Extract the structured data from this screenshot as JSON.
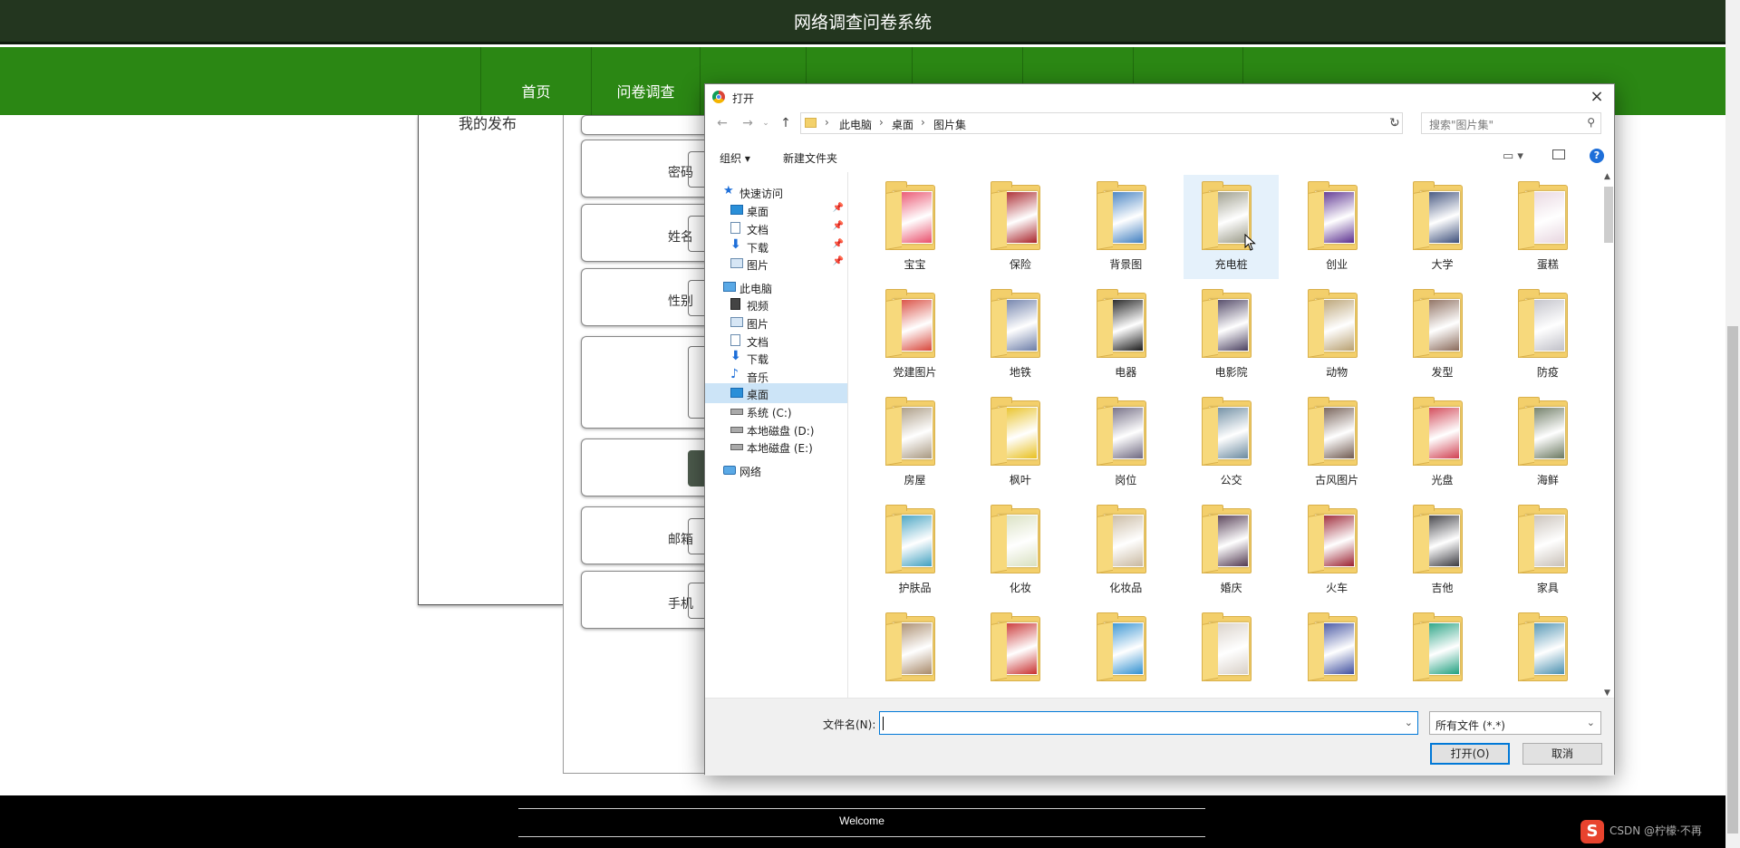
{
  "site": {
    "title": "网络调查问卷系统",
    "nav": [
      "首页",
      "问卷调查",
      "",
      "",
      "",
      "",
      ""
    ],
    "sidebar_link": "我的发布",
    "form_labels": [
      "密码",
      "姓名",
      "性别",
      "",
      "",
      "邮箱",
      "手机"
    ],
    "footer_text": "Welcome",
    "watermark": "CSDN @柠檬·不再"
  },
  "dialog": {
    "title": "打开",
    "close_icon": "×",
    "breadcrumbs": [
      "此电脑",
      "桌面",
      "图片集"
    ],
    "search_placeholder": "搜索\"图片集\"",
    "toolbar": {
      "organize": "组织 ▾",
      "new_folder": "新建文件夹",
      "help": "?"
    },
    "nav_pane": [
      {
        "label": "快速访问",
        "icon": "star",
        "pinned": false,
        "selected": false
      },
      {
        "label": "桌面",
        "icon": "desktop",
        "pinned": true,
        "selected": false
      },
      {
        "label": "文档",
        "icon": "doc",
        "pinned": true,
        "selected": false
      },
      {
        "label": "下载",
        "icon": "down",
        "pinned": true,
        "selected": false
      },
      {
        "label": "图片",
        "icon": "pic",
        "pinned": true,
        "selected": false
      },
      {
        "label": "此电脑",
        "icon": "pc",
        "pinned": false,
        "selected": false
      },
      {
        "label": "视频",
        "icon": "video",
        "pinned": false,
        "selected": false
      },
      {
        "label": "图片",
        "icon": "pic",
        "pinned": false,
        "selected": false
      },
      {
        "label": "文档",
        "icon": "doc",
        "pinned": false,
        "selected": false
      },
      {
        "label": "下载",
        "icon": "down",
        "pinned": false,
        "selected": false
      },
      {
        "label": "音乐",
        "icon": "music",
        "pinned": false,
        "selected": false
      },
      {
        "label": "桌面",
        "icon": "desktop",
        "pinned": false,
        "selected": true
      },
      {
        "label": "系统 (C:)",
        "icon": "drive",
        "pinned": false,
        "selected": false
      },
      {
        "label": "本地磁盘 (D:)",
        "icon": "drive",
        "pinned": false,
        "selected": false
      },
      {
        "label": "本地磁盘 (E:)",
        "icon": "drive",
        "pinned": false,
        "selected": false
      },
      {
        "label": "网络",
        "icon": "net",
        "pinned": false,
        "selected": false
      }
    ],
    "folders": [
      {
        "name": "宝宝",
        "selected": false
      },
      {
        "name": "保险",
        "selected": false
      },
      {
        "name": "背景图",
        "selected": false
      },
      {
        "name": "充电桩",
        "selected": true
      },
      {
        "name": "创业",
        "selected": false
      },
      {
        "name": "大学",
        "selected": false
      },
      {
        "name": "蛋糕",
        "selected": false
      },
      {
        "name": "党建图片",
        "selected": false
      },
      {
        "name": "地铁",
        "selected": false
      },
      {
        "name": "电器",
        "selected": false
      },
      {
        "name": "电影院",
        "selected": false
      },
      {
        "name": "动物",
        "selected": false
      },
      {
        "name": "发型",
        "selected": false
      },
      {
        "name": "防疫",
        "selected": false
      },
      {
        "name": "房屋",
        "selected": false
      },
      {
        "name": "枫叶",
        "selected": false
      },
      {
        "name": "岗位",
        "selected": false
      },
      {
        "name": "公交",
        "selected": false
      },
      {
        "name": "古风图片",
        "selected": false
      },
      {
        "name": "光盘",
        "selected": false
      },
      {
        "name": "海鲜",
        "selected": false
      },
      {
        "name": "护肤品",
        "selected": false
      },
      {
        "name": "化妆",
        "selected": false
      },
      {
        "name": "化妆品",
        "selected": false
      },
      {
        "name": "婚庆",
        "selected": false
      },
      {
        "name": "火车",
        "selected": false
      },
      {
        "name": "吉他",
        "selected": false
      },
      {
        "name": "家具",
        "selected": false
      },
      {
        "name": "",
        "selected": false
      },
      {
        "name": "",
        "selected": false
      },
      {
        "name": "",
        "selected": false
      },
      {
        "name": "",
        "selected": false
      },
      {
        "name": "",
        "selected": false
      },
      {
        "name": "",
        "selected": false
      },
      {
        "name": "",
        "selected": false
      }
    ],
    "folder_colors": [
      "#e94e6b",
      "#a8232a",
      "#3f7ec0",
      "#9a9a88",
      "#5a2f8f",
      "#3c4e7a",
      "#e8d6e0",
      "#d8463a",
      "#6c7da8",
      "#1a1a1a",
      "#4a4060",
      "#b8a070",
      "#8a6a5a",
      "#c0c0c8",
      "#a89880",
      "#e8c020",
      "#6e6880",
      "#6a8aa0",
      "#705a50",
      "#d04050",
      "#6a7860",
      "#40a0c0",
      "#d8e0c0",
      "#c8b8a0",
      "#503850",
      "#9a2030",
      "#3a3a40",
      "#c8c0b8",
      "#a88a6a",
      "#c83030",
      "#3090d0",
      "#d8d0c8",
      "#4050a0",
      "#20a080",
      "#4a90b0"
    ],
    "file_name_label": "文件名(N):",
    "file_name_value": "",
    "file_type": "所有文件 (*.*)",
    "open_button": "打开(O)",
    "cancel_button": "取消"
  }
}
